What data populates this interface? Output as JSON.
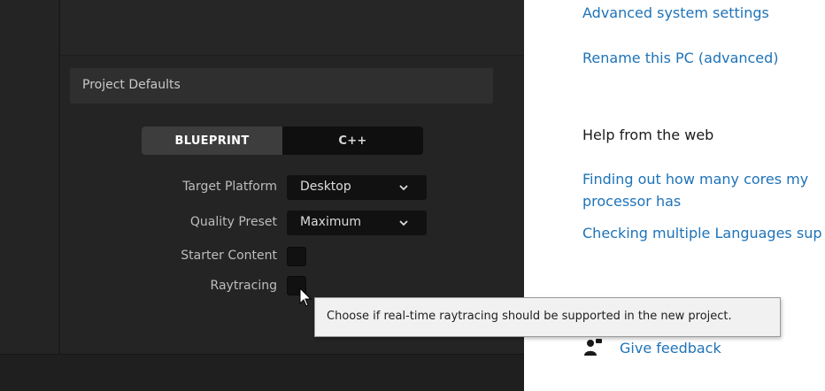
{
  "editor": {
    "section_title": "Project Defaults",
    "language_toggle": {
      "options": [
        "BLUEPRINT",
        "C++"
      ],
      "selected": "BLUEPRINT"
    },
    "settings": {
      "target_platform": {
        "label": "Target Platform",
        "value": "Desktop"
      },
      "quality_preset": {
        "label": "Quality Preset",
        "value": "Maximum"
      },
      "starter_content": {
        "label": "Starter Content",
        "checked": false
      },
      "raytracing": {
        "label": "Raytracing",
        "checked": false
      }
    },
    "tooltip": "Choose if real-time raytracing should be supported in the new project."
  },
  "system_panel": {
    "links": {
      "advanced_system_settings": "Advanced system settings",
      "rename_pc": "Rename this PC (advanced)"
    },
    "help_heading": "Help from the web",
    "help_links": {
      "cores": "Finding out how many cores my processor has",
      "languages": "Checking multiple Languages sup"
    },
    "feedback": "Give feedback"
  },
  "colors": {
    "editor_bg": "#242424",
    "link_blue": "#1e73b8",
    "tooltip_bg": "#f1f1f1"
  },
  "icons": {
    "dropdown": "chevron-down-icon",
    "cursor": "mouse-pointer-icon",
    "feedback": "feedback-person-icon"
  }
}
